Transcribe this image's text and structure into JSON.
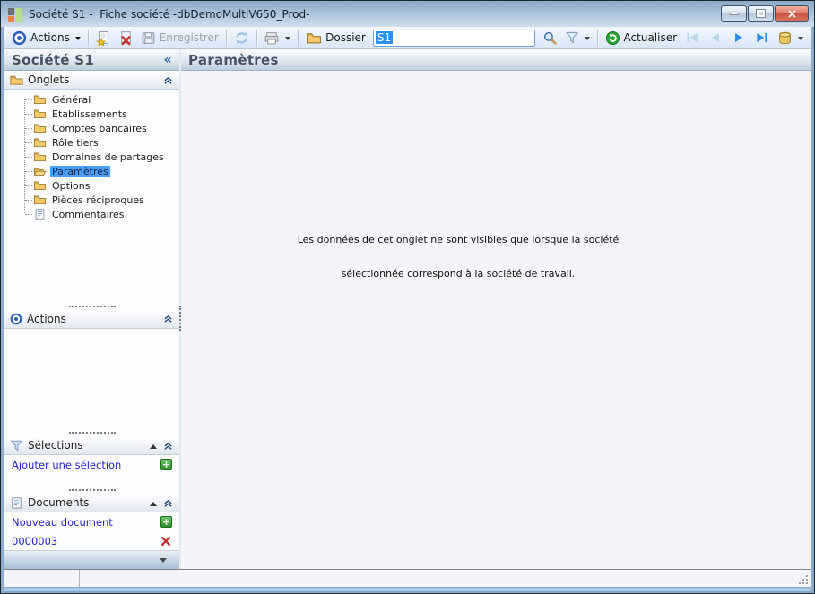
{
  "window": {
    "title": "Société S1 -  Fiche société -dbDemoMultiV650_Prod-"
  },
  "toolbar": {
    "actions_label": "Actions",
    "enregistrer_label": "Enregistrer",
    "dossier_label": "Dossier",
    "search_value": "S1",
    "actualiser_label": "Actualiser"
  },
  "sidebar": {
    "title": "Société S1",
    "collapse_glyph": "«",
    "onglets": {
      "label": "Onglets",
      "items": [
        {
          "label": "Général",
          "icon": "folder-closed",
          "selected": false
        },
        {
          "label": "Etablissements",
          "icon": "folder-closed",
          "selected": false
        },
        {
          "label": "Comptes bancaires",
          "icon": "folder-closed",
          "selected": false
        },
        {
          "label": "Rôle tiers",
          "icon": "folder-closed",
          "selected": false
        },
        {
          "label": "Domaines de partages",
          "icon": "folder-closed",
          "selected": false
        },
        {
          "label": "Paramètres",
          "icon": "folder-open",
          "selected": true
        },
        {
          "label": "Options",
          "icon": "folder-closed",
          "selected": false
        },
        {
          "label": "Pièces réciproques",
          "icon": "folder-closed",
          "selected": false
        },
        {
          "label": "Commentaires",
          "icon": "note",
          "selected": false
        }
      ]
    },
    "actions_section": {
      "label": "Actions"
    },
    "selections": {
      "label": "Sélections",
      "add_label": "Ajouter une sélection"
    },
    "documents": {
      "label": "Documents",
      "new_label": "Nouveau document",
      "items": [
        {
          "label": "0000003"
        }
      ]
    }
  },
  "main": {
    "title": "Paramètres",
    "message_line1": "Les données de cet onglet ne sont visibles que lorsque la société",
    "message_line2": "sélectionnée correspond à la société de travail."
  },
  "colors": {
    "accent_blue": "#2d8ce8",
    "tree_selection_bg": "#4b9ff7",
    "link_blue": "#2424c8",
    "folder_yellow": "#f7c96b",
    "actualiser_green": "#2fa33c",
    "delete_red": "#c43030",
    "disabled_text": "#9aa2ac"
  }
}
